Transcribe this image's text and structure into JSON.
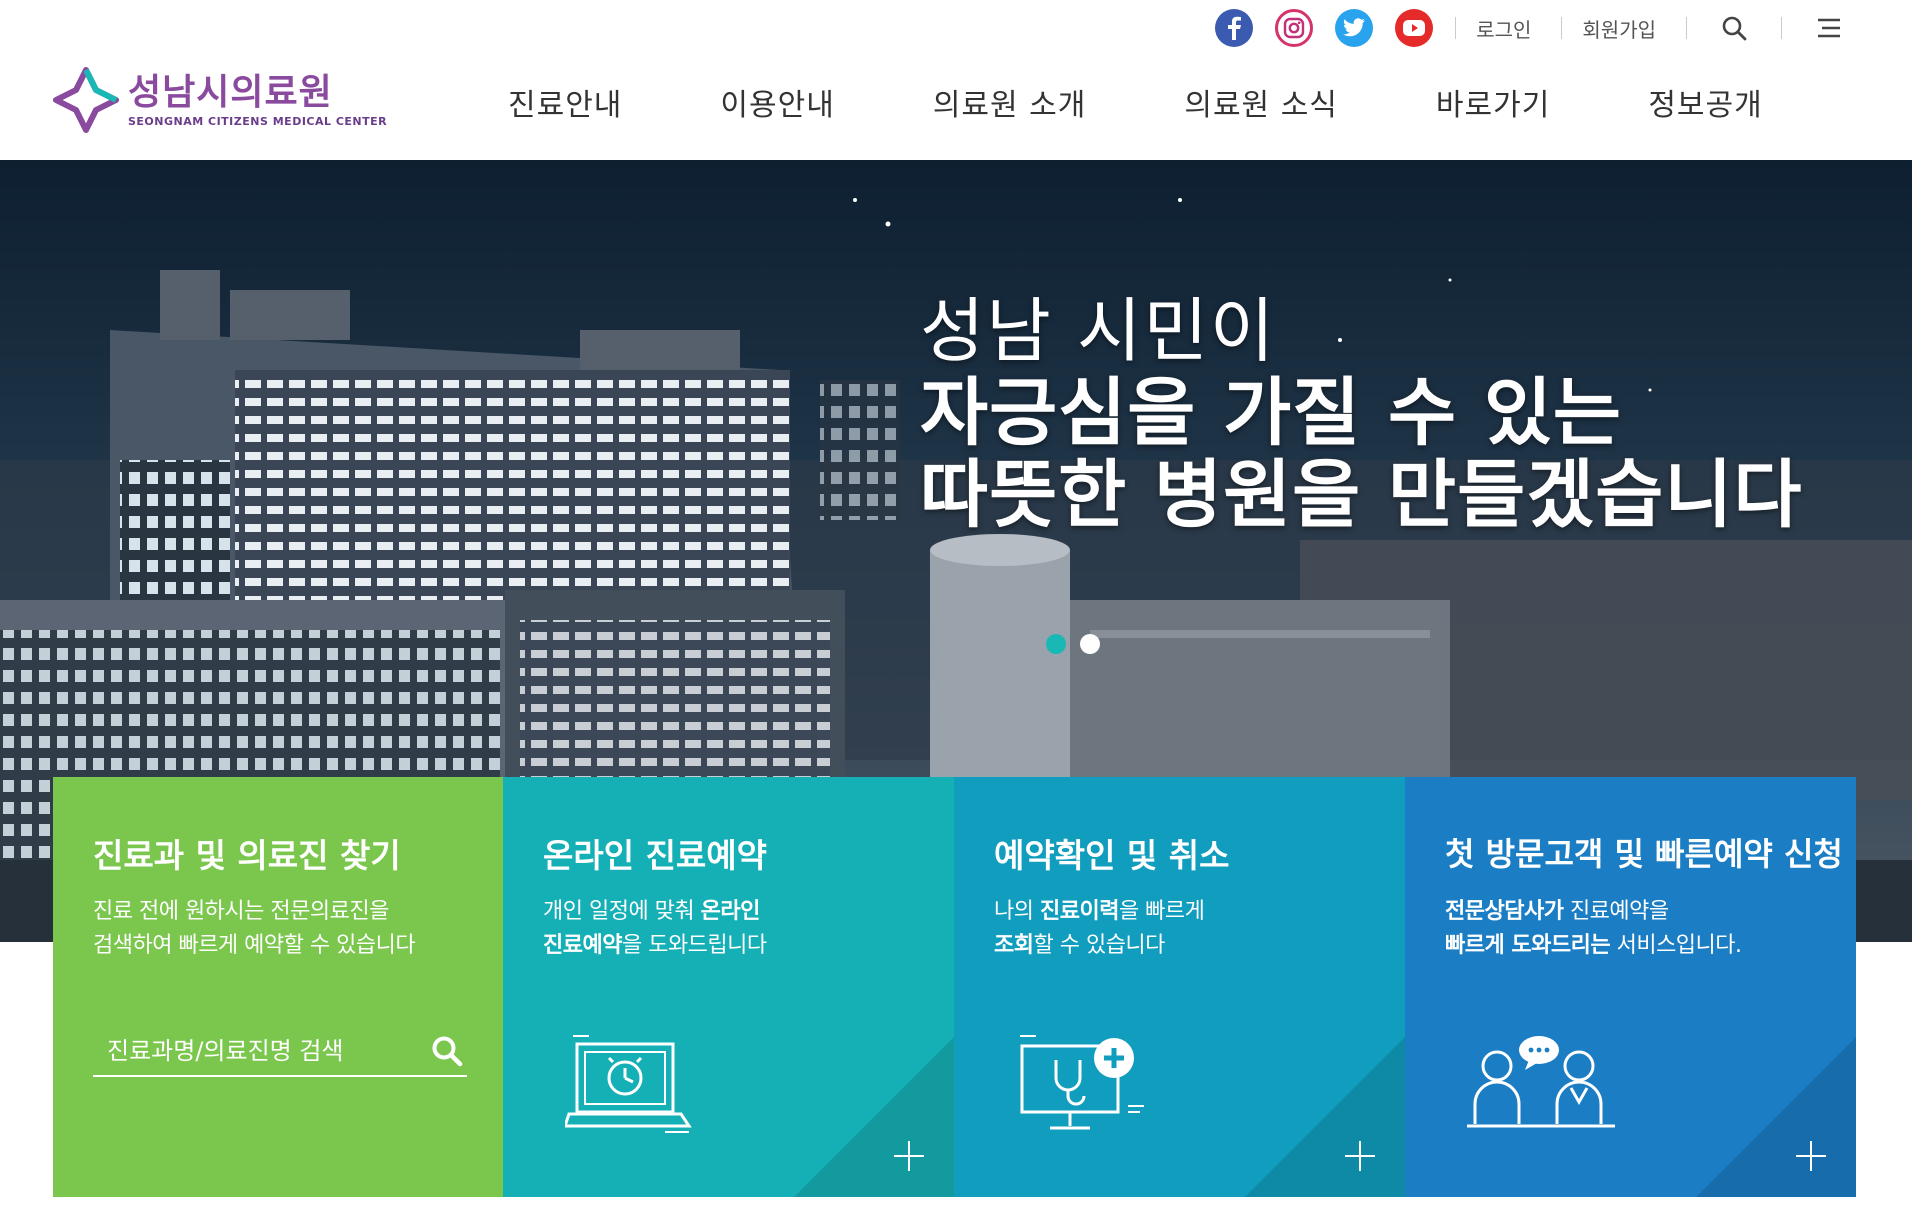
{
  "header": {
    "logo_name": "성남시의료원",
    "logo_sub": "SEONGNAM CITIZENS MEDICAL CENTER",
    "sns": [
      "facebook-icon",
      "instagram-icon",
      "twitter-icon",
      "youtube-icon"
    ],
    "login": "로그인",
    "signup": "회원가입",
    "nav": [
      "진료안내",
      "이용안내",
      "의료원 소개",
      "의료원 소식",
      "바로가기",
      "정보공개"
    ]
  },
  "hero": {
    "line1": "성남 시민이",
    "line2": "자긍심을 가질 수 있는",
    "line3": "따뜻한 병원을 만들겠습니다"
  },
  "cards": [
    {
      "title": "진료과 및 의료진 찾기",
      "desc1": "진료 전에 원하시는 전문의료진을",
      "desc2": "검색하여 빠르게 예약할 수 있습니다",
      "search_placeholder": "진료과명/의료진명 검색"
    },
    {
      "title": "온라인 진료예약",
      "d1a": "개인 일정에 맞춰 ",
      "d1b": "온라인",
      "d2a": "진료예약",
      "d2b": "을 도와드립니다"
    },
    {
      "title": "예약확인 및 취소",
      "d1a": "나의 ",
      "d1b": "진료이력",
      "d1c": "을 빠르게",
      "d2a": "조회",
      "d2b": "할 수 있습니다"
    },
    {
      "title": "첫 방문고객 및 빠른예약 신청",
      "d1a": "전문상담사가",
      "d1b": " 진료예약을",
      "d2a": "빠르게 도와드리는",
      "d2b": " 서비스입니다."
    }
  ],
  "colors": {
    "brand": "#8a4a9e",
    "card1": "#7bc74d",
    "card2": "#15b0b6",
    "card3": "#119dbe",
    "card4": "#1b7dc3"
  }
}
